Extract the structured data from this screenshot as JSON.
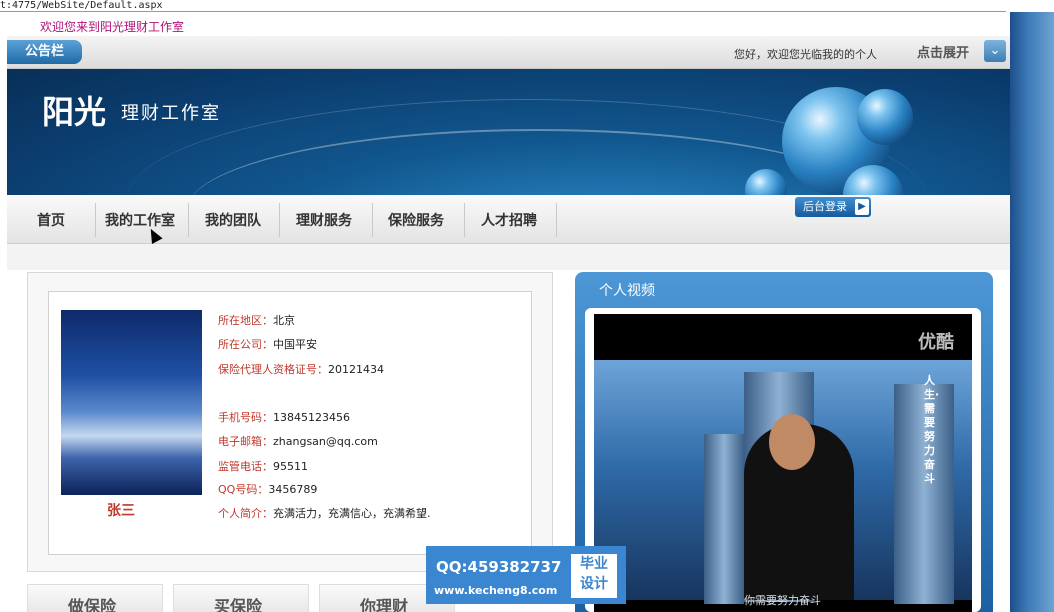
{
  "browser": {
    "address": "t:4775/WebSite/Default.aspx"
  },
  "topbar": {
    "welcome": "欢迎您来到阳光理财工作室"
  },
  "notice": {
    "tag": "公告栏",
    "message": "您好，欢迎您光临我的的个人",
    "expand_label": "点击展开",
    "expand_icon": "double-chevron-down-icon"
  },
  "banner": {
    "brand": "阳光",
    "subtitle": "理财工作室"
  },
  "nav": {
    "items": [
      "首页",
      "我的工作室",
      "我的团队",
      "理财服务",
      "保险服务",
      "人才招聘"
    ],
    "login_label": "后台登录"
  },
  "profile": {
    "name": "张三",
    "fields": [
      {
        "label": "所在地区：",
        "value": "北京"
      },
      {
        "label": "所在公司：",
        "value": "中国平安"
      },
      {
        "label": "保险代理人资格证号：",
        "value": "20121434"
      },
      {
        "label": "手机号码：",
        "value": "13845123456"
      },
      {
        "label": "电子邮箱：",
        "value": "zhangsan@qq.com"
      },
      {
        "label": "监管电话：",
        "value": "95511"
      },
      {
        "label": "QQ号码：",
        "value": "3456789"
      },
      {
        "label": "个人简介：",
        "value": "充满活力，充满信心，充满希望."
      }
    ]
  },
  "video": {
    "title": "个人视频",
    "logo": "优酷",
    "vertical_text": "人生·需要努力奋斗",
    "caption": "你需要努力奋斗"
  },
  "tiles": [
    "做保险",
    "买保险",
    "你理财"
  ],
  "watermark": {
    "qq": "QQ:459382737",
    "url": "www.kecheng8.com",
    "badge_line1": "毕业",
    "badge_line2": "设计"
  },
  "colors": {
    "accent": "#1f6aa8",
    "label_red": "#c0392b",
    "welcome_pink": "#b0107a"
  }
}
